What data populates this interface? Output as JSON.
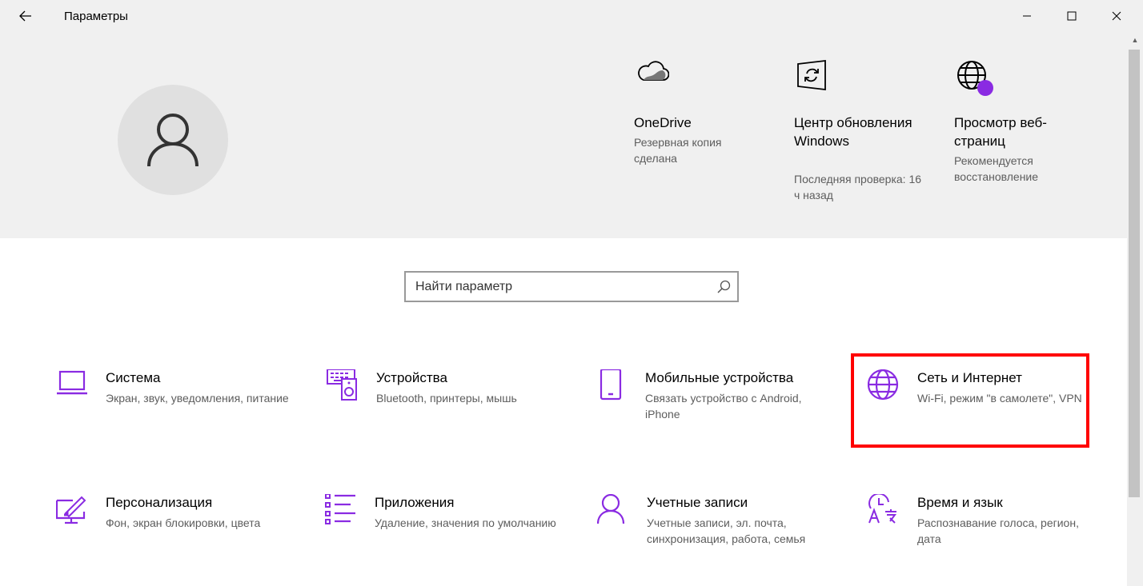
{
  "window": {
    "title": "Параметры"
  },
  "controls": {
    "back": "back-arrow",
    "minimize": "—",
    "maximize": "☐",
    "close": "✕"
  },
  "status": [
    {
      "icon": "cloud-icon",
      "title": "OneDrive",
      "subtitle": "Резервная копия сделана"
    },
    {
      "icon": "windows-update-icon",
      "title": "Центр обновления Windows",
      "subtitle": "Последняя проверка: 16 ч назад"
    },
    {
      "icon": "globe-alert-icon",
      "title": "Просмотр веб-страниц",
      "subtitle": "Рекомендуется восстановление"
    }
  ],
  "search": {
    "placeholder": "Найти параметр"
  },
  "categories": [
    {
      "icon": "laptop-icon",
      "title": "Система",
      "subtitle": "Экран, звук, уведомления, питание"
    },
    {
      "icon": "devices-icon",
      "title": "Устройства",
      "subtitle": "Bluetooth, принтеры, мышь"
    },
    {
      "icon": "phone-icon",
      "title": "Мобильные устройства",
      "subtitle": "Связать устройство с Android, iPhone"
    },
    {
      "icon": "globe-icon",
      "title": "Сеть и Интернет",
      "subtitle": "Wi-Fi, режим \"в самолете\", VPN"
    },
    {
      "icon": "personalization-icon",
      "title": "Персонализация",
      "subtitle": "Фон, экран блокировки, цвета"
    },
    {
      "icon": "apps-icon",
      "title": "Приложения",
      "subtitle": "Удаление, значения по умолчанию"
    },
    {
      "icon": "account-icon",
      "title": "Учетные записи",
      "subtitle": "Учетные записи, эл. почта, синхронизация, работа, семья"
    },
    {
      "icon": "time-language-icon",
      "title": "Время и язык",
      "subtitle": "Распознавание голоса, регион, дата"
    }
  ],
  "colors": {
    "accent": "#8a2be2",
    "highlight": "#ff0000",
    "hero_bg": "#f0f0f0"
  }
}
